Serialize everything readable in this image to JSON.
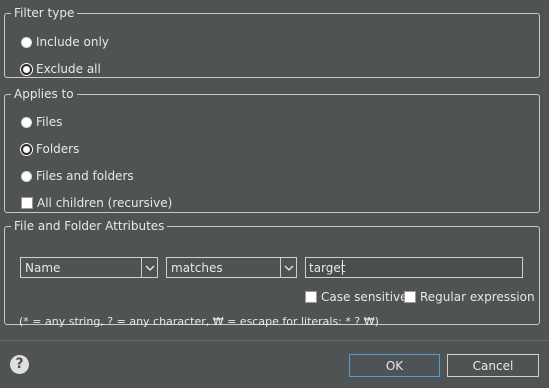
{
  "filter_type": {
    "legend": "Filter type",
    "options": [
      {
        "label": "Include only",
        "checked": false
      },
      {
        "label": "Exclude all",
        "checked": true
      }
    ]
  },
  "applies_to": {
    "legend": "Applies to",
    "options": [
      {
        "label": "Files",
        "checked": false
      },
      {
        "label": "Folders",
        "checked": true
      },
      {
        "label": "Files and folders",
        "checked": false
      }
    ],
    "recursive_label": "All children (recursive)",
    "recursive_checked": false
  },
  "attributes": {
    "legend": "File and Folder Attributes",
    "attribute_select": "Name",
    "operator_select": "matches",
    "value": "target",
    "case_sensitive_label": "Case sensitive",
    "case_sensitive_checked": false,
    "regex_label": "Regular expression",
    "regex_checked": false,
    "hint": "(* = any string, ? = any character, ₩ = escape for literals: * ? ₩)"
  },
  "footer": {
    "help_glyph": "?",
    "ok_label": "OK",
    "cancel_label": "Cancel"
  },
  "colors": {
    "background": "#505354",
    "text": "#e8e8e8",
    "default_button_border": "#4a9fe0"
  }
}
